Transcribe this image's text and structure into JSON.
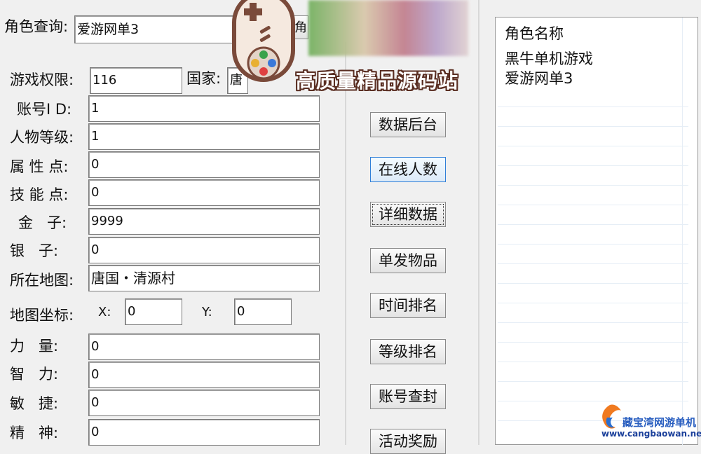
{
  "search": {
    "label": "角色查询:",
    "value": "爱游网单3",
    "button_label": "取角"
  },
  "form": {
    "perm_label": "游戏权限:",
    "perm_value": "116",
    "country_label": "国家:",
    "country_value": "唐",
    "account_label": "账号I D:",
    "account_value": "1",
    "level_label": "人物等级:",
    "level_value": "1",
    "attr_label": "属 性 点:",
    "attr_value": "0",
    "skill_label": "技 能 点:",
    "skill_value": "0",
    "gold_label": "金   子:",
    "gold_value": "9999",
    "silver_label": "银   子:",
    "silver_value": "0",
    "map_label": "所在地图:",
    "map_value": "唐国・清源村",
    "coord_label": "地图坐标:",
    "x_label": "X:",
    "x_value": "0",
    "y_label": "Y:",
    "y_value": "0",
    "str_label": "力   量:",
    "str_value": "0",
    "int_label": "智   力:",
    "int_value": "0",
    "agi_label": "敏   捷:",
    "agi_value": "0",
    "spi_label": "精   神:",
    "spi_value": "0"
  },
  "buttons": [
    "数据后台",
    "在线人数",
    "详细数据",
    "单发物品",
    "时间排名",
    "等级排名",
    "账号查封",
    "活动奖励"
  ],
  "role_list": {
    "header": "角色名称",
    "items": [
      "黑牛单机游戏",
      "爱游网单3"
    ]
  },
  "overlay": {
    "banner_text": "高质量精品源码站",
    "watermark_text": "藏宝湾网游单机",
    "watermark_url": "www.cangbaowan.net"
  },
  "colors": {
    "window_bg": "#f0f0f0",
    "focus_border": "#2f7fd8",
    "banner_text": "#ffffff"
  }
}
